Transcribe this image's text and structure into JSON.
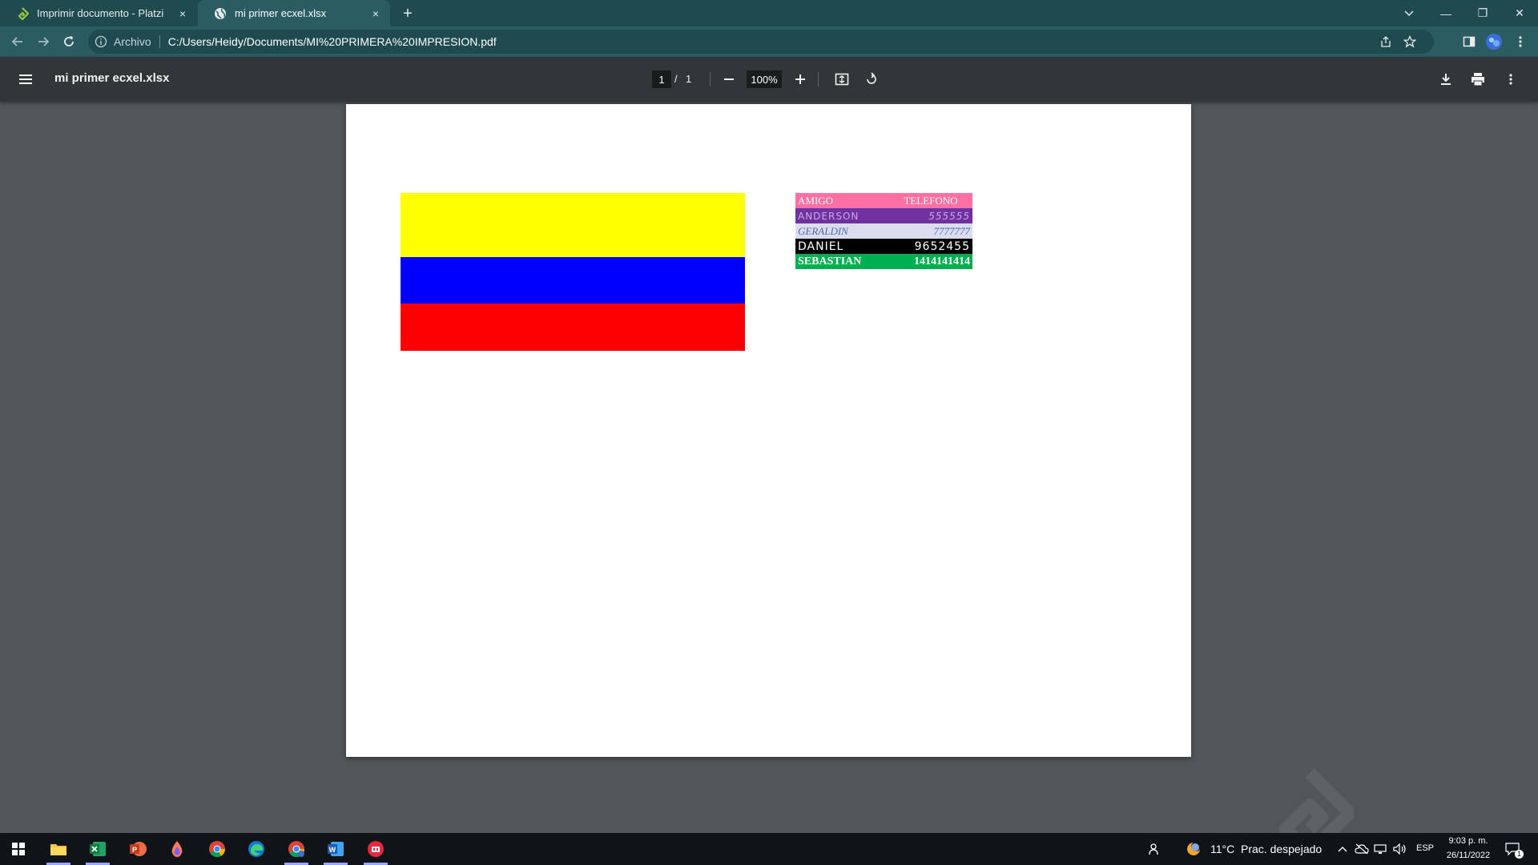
{
  "tabs": [
    {
      "title": "Imprimir documento - Platzi",
      "close": "×",
      "favicon": "platzi-icon"
    },
    {
      "title": "mi primer ecxel.xlsx",
      "close": "×",
      "favicon": "globe-icon"
    }
  ],
  "new_tab": "+",
  "window_controls": {
    "minimize": "—",
    "restore": "❐",
    "close": "✕"
  },
  "address": {
    "security_chip": "Archivo",
    "url": "C:/Users/Heidy/Documents/MI%20PRIMERA%20IMPRESION.pdf"
  },
  "pdf_viewer": {
    "title": "mi primer ecxel.xlsx",
    "current_page": "1",
    "page_separator": "/",
    "total_pages": "1",
    "zoom": "100%"
  },
  "document": {
    "flag_colors": [
      "#ffff00",
      "#0000ff",
      "#ff0000"
    ],
    "table": {
      "headers": [
        "AMIGO",
        "TELEFONO"
      ],
      "rows": [
        [
          "ANDERSON",
          "555555"
        ],
        [
          "GERALDIN",
          "7777777"
        ],
        [
          "DANIEL",
          "9652455"
        ],
        [
          "SEBASTIAN",
          "1414141414"
        ]
      ]
    }
  },
  "taskbar": {
    "apps": [
      "windows-start",
      "file-explorer",
      "excel",
      "powerpoint",
      "paint-drop",
      "chrome",
      "edge",
      "chrome-profile",
      "word",
      "red-app"
    ],
    "weather_temp": "11°C",
    "weather_text": "Prac. despejado",
    "language": "ESP",
    "time": "9:03 p. m.",
    "date": "26/11/2022",
    "notification_count": "1"
  }
}
